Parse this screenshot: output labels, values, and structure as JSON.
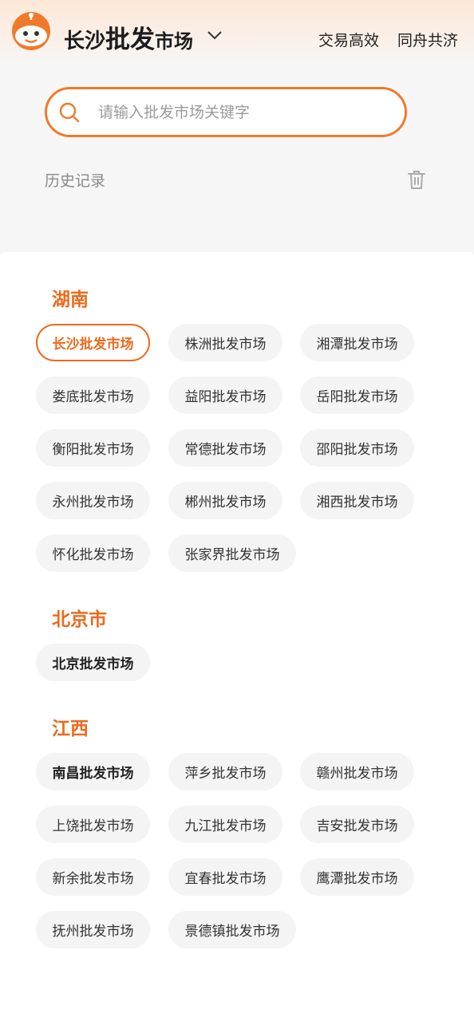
{
  "header": {
    "city": "长沙",
    "title_big": "批发",
    "title_small": "市场",
    "slogans": [
      "交易高效",
      "同舟共济"
    ],
    "logo_icon": "mascot-logo-icon",
    "dropdown_icon": "chevron-down-icon"
  },
  "search": {
    "placeholder": "请输入批发市场关键字",
    "value": "",
    "icon": "search-icon"
  },
  "history": {
    "label": "历史记录",
    "clear_icon": "trash-icon"
  },
  "colors": {
    "accent": "#ec6a1c",
    "chip_bg": "#f4f4f4",
    "page_bg": "#f6f6f6"
  },
  "regions": [
    {
      "name": "湖南",
      "markets": [
        "长沙批发市场",
        "株洲批发市场",
        "湘潭批发市场",
        "娄底批发市场",
        "益阳批发市场",
        "岳阳批发市场",
        "衡阳批发市场",
        "常德批发市场",
        "邵阳批发市场",
        "永州批发市场",
        "郴州批发市场",
        "湘西批发市场",
        "怀化批发市场",
        "张家界批发市场"
      ],
      "selected": "长沙批发市场"
    },
    {
      "name": "北京市",
      "markets": [
        "北京批发市场"
      ]
    },
    {
      "name": "江西",
      "markets": [
        "南昌批发市场",
        "萍乡批发市场",
        "赣州批发市场",
        "上饶批发市场",
        "九江批发市场",
        "吉安批发市场",
        "新余批发市场",
        "宜春批发市场",
        "鹰潭批发市场",
        "抚州批发市场",
        "景德镇批发市场"
      ]
    }
  ]
}
